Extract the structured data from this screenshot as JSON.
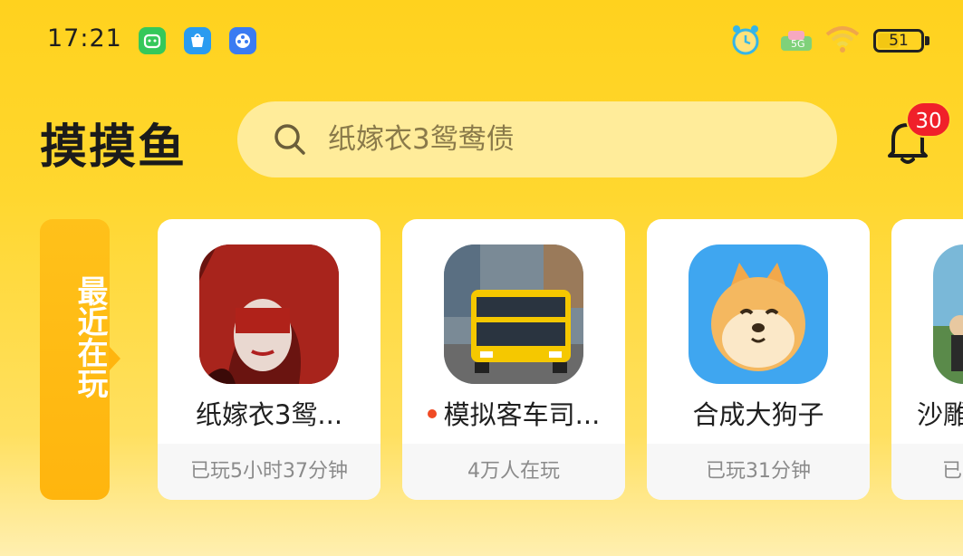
{
  "status_bar": {
    "time": "17:21",
    "left_icons": [
      "app-face-icon",
      "shopping-bag-icon",
      "video-reel-icon"
    ],
    "right_icons": [
      "alarm-icon",
      "data-network-icon",
      "wifi-icon"
    ],
    "battery": 51
  },
  "header": {
    "logo": "摸摸鱼",
    "search_placeholder": "纸嫁衣3鸳鸯债",
    "notification_count": "30"
  },
  "recent": {
    "tab_label": "最近在玩",
    "cards": [
      {
        "title": "纸嫁衣3鸳...",
        "subtitle": "已玩5小时37分钟",
        "icon": "bride-red-veil-icon",
        "new_dot": false
      },
      {
        "title": "模拟客车司...",
        "subtitle": "4万人在玩",
        "icon": "yellow-bus-icon",
        "new_dot": true
      },
      {
        "title": "合成大狗子",
        "subtitle": "已玩31分钟",
        "icon": "shiba-dog-icon",
        "new_dot": false
      },
      {
        "title": "沙雕",
        "subtitle": "已",
        "icon": "game-scene-icon",
        "new_dot": false
      }
    ]
  },
  "colors": {
    "background": "#FFD72F",
    "badge": "#F0202A",
    "recent_tab": "#FFB50E",
    "dot": "#F04A24"
  }
}
